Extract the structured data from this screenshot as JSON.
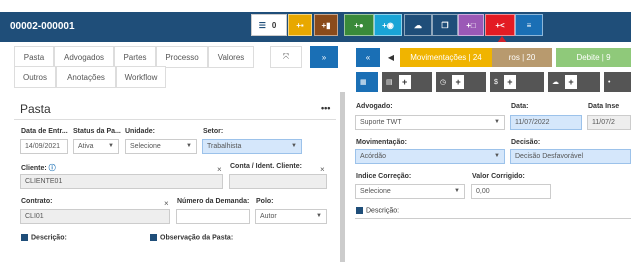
{
  "header": {
    "title": "00002-000001"
  },
  "toolbar": {
    "list_count": "0"
  },
  "left": {
    "tabs": [
      "Pasta",
      "Advogados",
      "Partes",
      "Processo",
      "Valores",
      "Outros",
      "Anotações",
      "Workflow"
    ],
    "section_title": "Pasta",
    "menu_glyph": "•••",
    "fields": {
      "data_entrada": {
        "label": "Data de Entr...",
        "value": "14/09/2021"
      },
      "status": {
        "label": "Status da Pa...",
        "value": "Ativa"
      },
      "unidade": {
        "label": "Unidade:",
        "value": "Selecione"
      },
      "setor": {
        "label": "Setor:",
        "value": "Trabalhista"
      },
      "cliente": {
        "label": "Cliente:",
        "value": "CLIENTE01"
      },
      "conta": {
        "label": "Conta / Ident. Cliente:",
        "value": ""
      },
      "contrato": {
        "label": "Contrato:",
        "value": "CLI01"
      },
      "numero_demanda": {
        "label": "Número da Demanda:",
        "value": ""
      },
      "polo": {
        "label": "Polo:",
        "value": "Autor"
      }
    },
    "descricao_label": "Descrição:",
    "observacao_label": "Observação da Pasta:"
  },
  "right": {
    "collapse_glyph": "«",
    "movimentacoes": {
      "label": "Movimentações",
      "count": "24"
    },
    "partial_tab": {
      "label": "ros",
      "count": "20"
    },
    "debite": {
      "label": "Debite",
      "count": "9"
    },
    "fields": {
      "advogado": {
        "label": "Advogado:",
        "value": "Suporte TWT"
      },
      "data": {
        "label": "Data:",
        "value": "11/07/2022"
      },
      "data_insercao": {
        "label": "Data Inse",
        "value": "11/07/2"
      },
      "movimentacao": {
        "label": "Movimentação:",
        "value": "Acórdão"
      },
      "decisao": {
        "label": "Decisão:",
        "value": "Decisão Desfavorável"
      },
      "indice": {
        "label": "Indice Correção:",
        "value": "Selecione"
      },
      "valor_corrigido": {
        "label": "Valor Corrigido:",
        "value": "0,00"
      }
    },
    "descricao_label": "Descrição:"
  },
  "colors": {
    "header": "#1f4e79",
    "highlight_red": "#e31b23",
    "movimentacoes": "#f0b400",
    "debite": "#8fc97a"
  }
}
